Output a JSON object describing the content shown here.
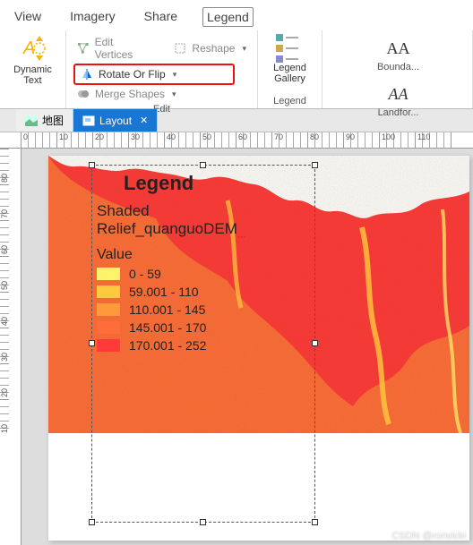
{
  "ribbon_tabs": {
    "view": "View",
    "imagery": "Imagery",
    "share": "Share",
    "legend": "Legend"
  },
  "insert": {
    "dynamic_text": "Dynamic\nText",
    "group_label": ""
  },
  "edit": {
    "edit_vertices": "Edit Vertices",
    "reshape": "Reshape",
    "rotate_flip": "Rotate Or Flip",
    "merge_shapes": "Merge Shapes",
    "group_label": "Edit"
  },
  "legend_group": {
    "gallery": "Legend\nGallery",
    "group_label": "Legend"
  },
  "text_styles": {
    "bounda": "Bounda...",
    "landfor": "Landfor..."
  },
  "doc_tabs": {
    "map": "地图",
    "layout": "Layout"
  },
  "ruler_h": [
    "0",
    "10",
    "20",
    "30",
    "40",
    "50",
    "60",
    "70",
    "80",
    "90",
    "100",
    "110"
  ],
  "ruler_v": [
    "80",
    "70",
    "60",
    "50",
    "40",
    "30",
    "20",
    "10"
  ],
  "legend_overlay": {
    "title": "Legend",
    "layer_line1": "Shaded",
    "layer_line2": "Relief_quanguoDEM",
    "value_label": "Value",
    "items": [
      {
        "color": "#fff36b",
        "label": "0 - 59"
      },
      {
        "color": "#ffc93f",
        "label": "59.001 - 110"
      },
      {
        "color": "#ff9a3a",
        "label": "110.001 - 145"
      },
      {
        "color": "#ff6e3a",
        "label": "145.001 - 170"
      },
      {
        "color": "#ff3a3a",
        "label": "170.001 - 252"
      }
    ]
  },
  "watermark": "CSDN @ronvicki"
}
